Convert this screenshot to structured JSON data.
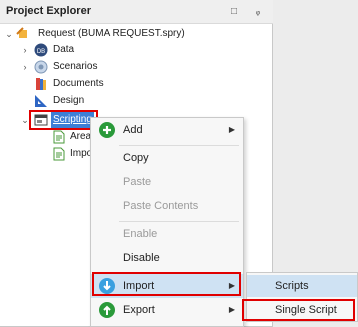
{
  "panel": {
    "title": "Project Explorer",
    "minimize_glyph": "□",
    "pin_glyph": "ᵩ"
  },
  "tree": {
    "root_label": "Request (BUMA REQUEST.spry)",
    "data_label": "Data",
    "scenarios_label": "Scenarios",
    "documents_label": "Documents",
    "design_label": "Design",
    "scripting_label": "Scripting",
    "child1_label": "AreaD",
    "child2_label": "Impor"
  },
  "context_menu": {
    "add": "Add",
    "copy": "Copy",
    "paste": "Paste",
    "paste_contents": "Paste Contents",
    "enable": "Enable",
    "disable": "Disable",
    "import": "Import",
    "export": "Export"
  },
  "submenu": {
    "scripts": "Scripts",
    "single_script": "Single Script"
  },
  "colors": {
    "selection": "#3d7fd6",
    "highlight_red": "#e00000",
    "hover": "#cfe2f3",
    "add_green": "#2a9a3a",
    "import_blue": "#39a0e0",
    "export_green": "#2a9a3a"
  }
}
